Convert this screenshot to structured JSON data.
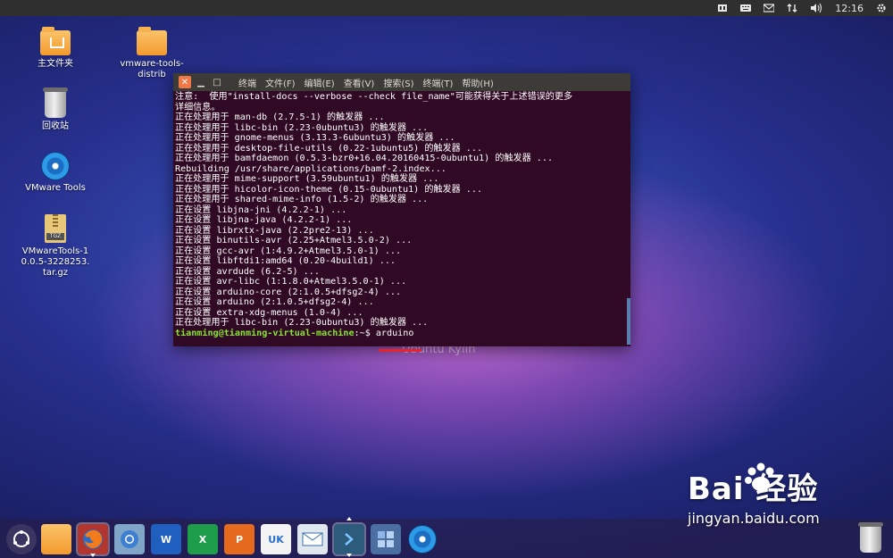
{
  "top_panel": {
    "clock": "12:16",
    "icons": [
      "input-method-icon",
      "keyboard-icon",
      "mail-icon",
      "network-icon",
      "volume-icon",
      "gear-icon"
    ]
  },
  "desktop_icons": [
    {
      "label": "主文件夹",
      "icon": "home-folder-icon"
    },
    {
      "label": "vmware-tools-distrib",
      "icon": "folder-icon"
    },
    {
      "label": "回收站",
      "icon": "trash-icon"
    },
    {
      "label": "VMware Tools",
      "icon": "disc-icon"
    },
    {
      "label": "VMwareTools-10.0.5-3228253.tar.gz",
      "icon": "archive-icon",
      "badge": "TGZ"
    }
  ],
  "terminal": {
    "title": "终端",
    "menu": [
      "文件(F)",
      "编辑(E)",
      "查看(V)",
      "搜索(S)",
      "终端(T)",
      "帮助(H)"
    ],
    "lines": [
      "注意:  使用\"install-docs --verbose --check file_name\"可能获得关于上述错误的更多",
      "详细信息。",
      "正在处理用于 man-db (2.7.5-1) 的触发器 ...",
      "正在处理用于 libc-bin (2.23-0ubuntu3) 的触发器 ...",
      "正在处理用于 gnome-menus (3.13.3-6ubuntu3) 的触发器 ...",
      "正在处理用于 desktop-file-utils (0.22-1ubuntu5) 的触发器 ...",
      "正在处理用于 bamfdaemon (0.5.3-bzr0+16.04.20160415-0ubuntu1) 的触发器 ...",
      "Rebuilding /usr/share/applications/bamf-2.index...",
      "正在处理用于 mime-support (3.59ubuntu1) 的触发器 ...",
      "正在处理用于 hicolor-icon-theme (0.15-0ubuntu1) 的触发器 ...",
      "正在处理用于 shared-mime-info (1.5-2) 的触发器 ...",
      "正在设置 libjna-jni (4.2.2-1) ...",
      "正在设置 libjna-java (4.2.2-1) ...",
      "正在设置 librxtx-java (2.2pre2-13) ...",
      "正在设置 binutils-avr (2.25+Atmel3.5.0-2) ...",
      "正在设置 gcc-avr (1:4.9.2+Atmel3.5.0-1) ...",
      "正在设置 libftdi1:amd64 (0.20-4build1) ...",
      "正在设置 avrdude (6.2-5) ...",
      "正在设置 avr-libc (1:1.8.0+Atmel3.5.0-1) ...",
      "正在设置 arduino-core (2:1.0.5+dfsg2-4) ...",
      "正在设置 arduino (2:1.0.5+dfsg2-4) ...",
      "正在设置 extra-xdg-menus (1.0-4) ...",
      "正在处理用于 libc-bin (2.23-0ubuntu3) 的触发器 ..."
    ],
    "prompt_user": "tianming@tianming-virtual-machine",
    "prompt_sep": ":~$ ",
    "command": "arduino"
  },
  "wallpaper_text": "Ubuntu Kylin",
  "dock": {
    "icons": [
      "dash-icon",
      "files-icon",
      "firefox-icon",
      "chromium-icon",
      "writer-icon",
      "spreadsheet-icon",
      "presentation-icon",
      "software-center-icon",
      "mail-client-icon",
      "terminal-icon",
      "workspace-switcher-icon",
      "dvd-icon",
      "trash-icon"
    ],
    "labels": {
      "software_center": "UK"
    }
  },
  "watermark": {
    "logo": "Bai 经验",
    "url": "jingyan.baidu.com"
  }
}
